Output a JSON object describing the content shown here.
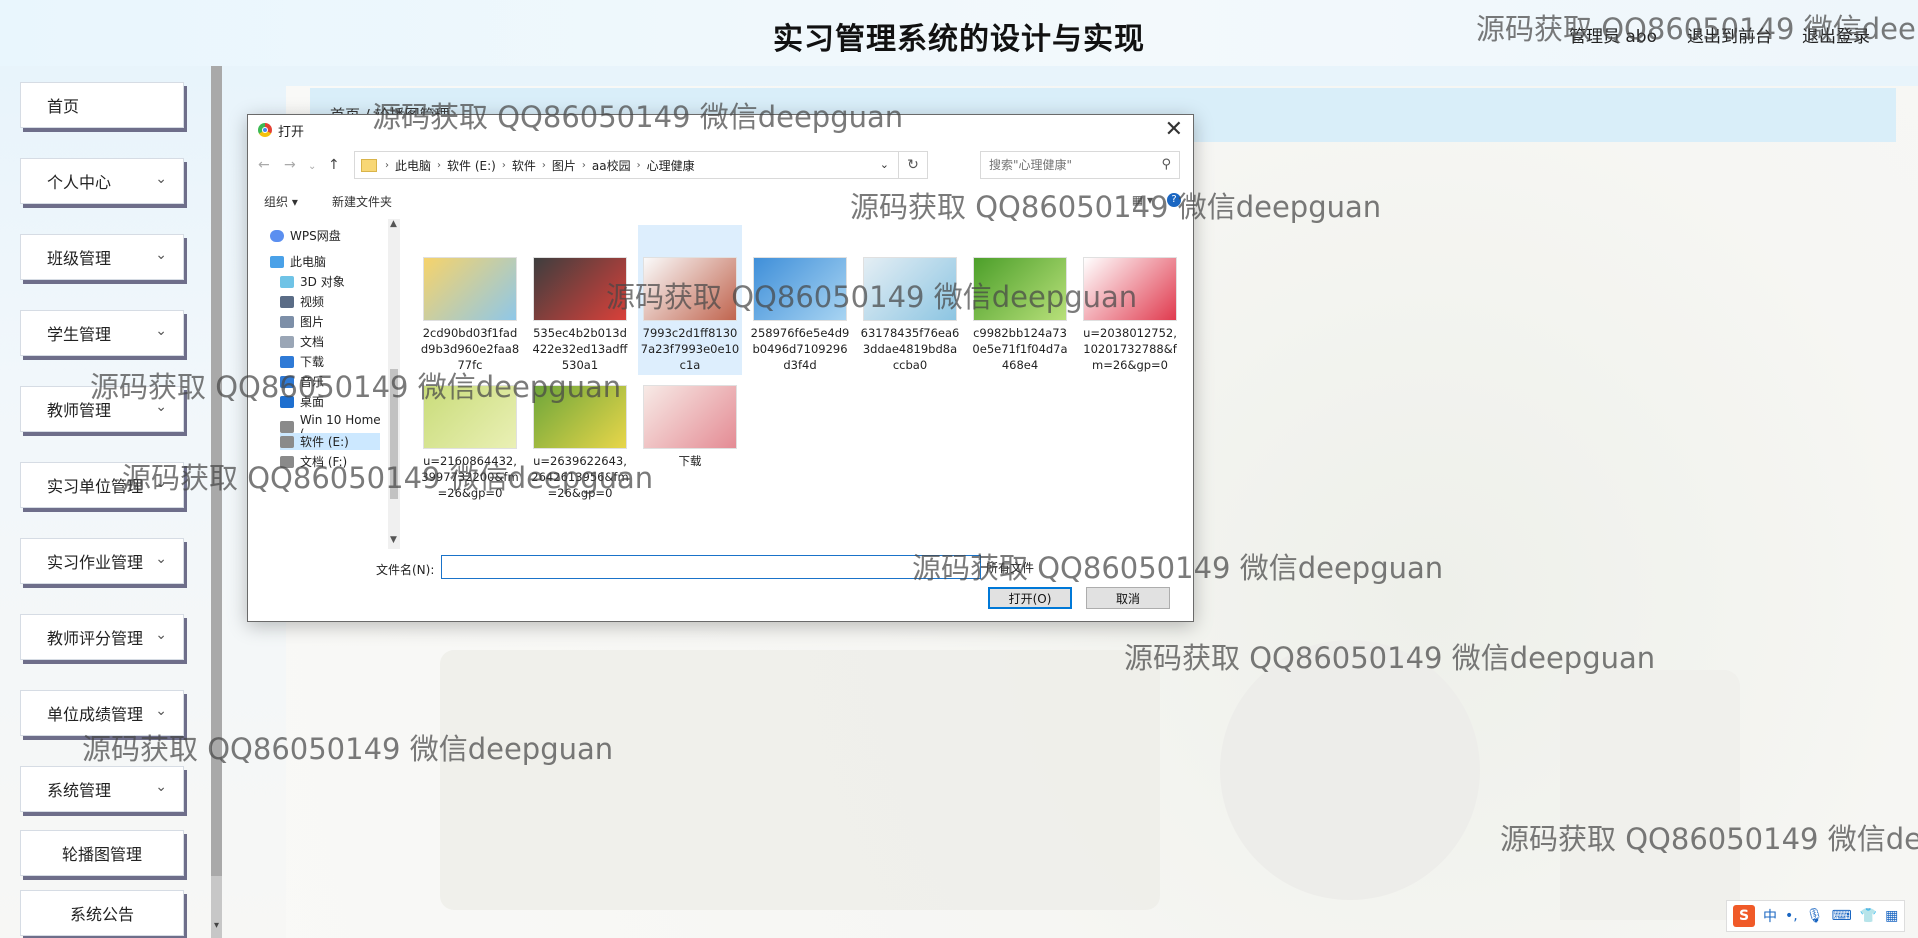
{
  "header": {
    "title": "实习管理系统的设计与实现",
    "links": [
      "管理员 abo",
      "退出到前台",
      "退出登录"
    ]
  },
  "sidebar": {
    "items": [
      {
        "label": "首页",
        "chevron": false
      },
      {
        "label": "个人中心",
        "chevron": true
      },
      {
        "label": "班级管理",
        "chevron": true
      },
      {
        "label": "学生管理",
        "chevron": true
      },
      {
        "label": "教师管理",
        "chevron": true
      },
      {
        "label": "实习单位管理",
        "chevron": true
      },
      {
        "label": "实习作业管理",
        "chevron": true
      },
      {
        "label": "教师评分管理",
        "chevron": true
      },
      {
        "label": "单位成绩管理",
        "chevron": true
      },
      {
        "label": "系统管理",
        "chevron": true
      },
      {
        "label": "轮播图管理",
        "chevron": false
      },
      {
        "label": "系统公告",
        "chevron": false
      }
    ]
  },
  "breadcrumb": {
    "text": "首页 / 轮播图管理"
  },
  "dialog": {
    "title": "打开",
    "address": [
      "此电脑",
      "软件 (E:)",
      "软件",
      "图片",
      "aa校园",
      "心理健康"
    ],
    "search_placeholder": "搜索\"心理健康\"",
    "toolbar": {
      "organize": "组织 ▾",
      "new_folder": "新建文件夹"
    },
    "nav_pane": [
      "WPS网盘",
      "此电脑",
      "3D 对象",
      "视频",
      "图片",
      "文档",
      "下载",
      "音乐",
      "桌面",
      "Win 10 Home (",
      "软件 (E:)",
      "文档 (F:)"
    ],
    "files": [
      {
        "name": "2cd90bd03f1fadd9b3d960e2faa877fc",
        "colors": [
          "#f6d36b",
          "#8fc7e8"
        ]
      },
      {
        "name": "535ec4b2b013d422e32ed13adff530a1",
        "colors": [
          "#3e3e3e",
          "#d9403a"
        ]
      },
      {
        "name": "7993c2d1ff81307a23f7993e0e10c1a",
        "colors": [
          "#fafafa",
          "#c0644e"
        ]
      },
      {
        "name": "258976f6e5e4d9b0496d7109296d3f4d",
        "colors": [
          "#3f8fd9",
          "#a8d4f2"
        ]
      },
      {
        "name": "63178435f76ea63ddae4819bd8accba0",
        "colors": [
          "#e4eef4",
          "#8cc5e2"
        ]
      },
      {
        "name": "c9982bb124a730e5e71f1f04d7a468e4",
        "colors": [
          "#4c9f2a",
          "#b8e07a"
        ]
      },
      {
        "name": "u=2038012752,10201732788&fm=26&gp=0",
        "colors": [
          "#ffffff",
          "#e03a4e"
        ]
      },
      {
        "name": "u=2160864432,3997732200&fm=26&gp=0",
        "colors": [
          "#c9dc7a",
          "#eaf0b5"
        ]
      },
      {
        "name": "u=2639622643,2642613956&fm=26&gp=0",
        "colors": [
          "#6ea63a",
          "#e8d64a"
        ]
      },
      {
        "name": "下载",
        "colors": [
          "#f7eae6",
          "#e48b94"
        ]
      }
    ],
    "filename_label": "文件名(N):",
    "filename_value": "",
    "filter": "所有文件",
    "open": "打开(O)",
    "cancel": "取消"
  },
  "watermark": "源码获取 QQ86050149 微信deepguan",
  "ime": {
    "mode": "中"
  }
}
